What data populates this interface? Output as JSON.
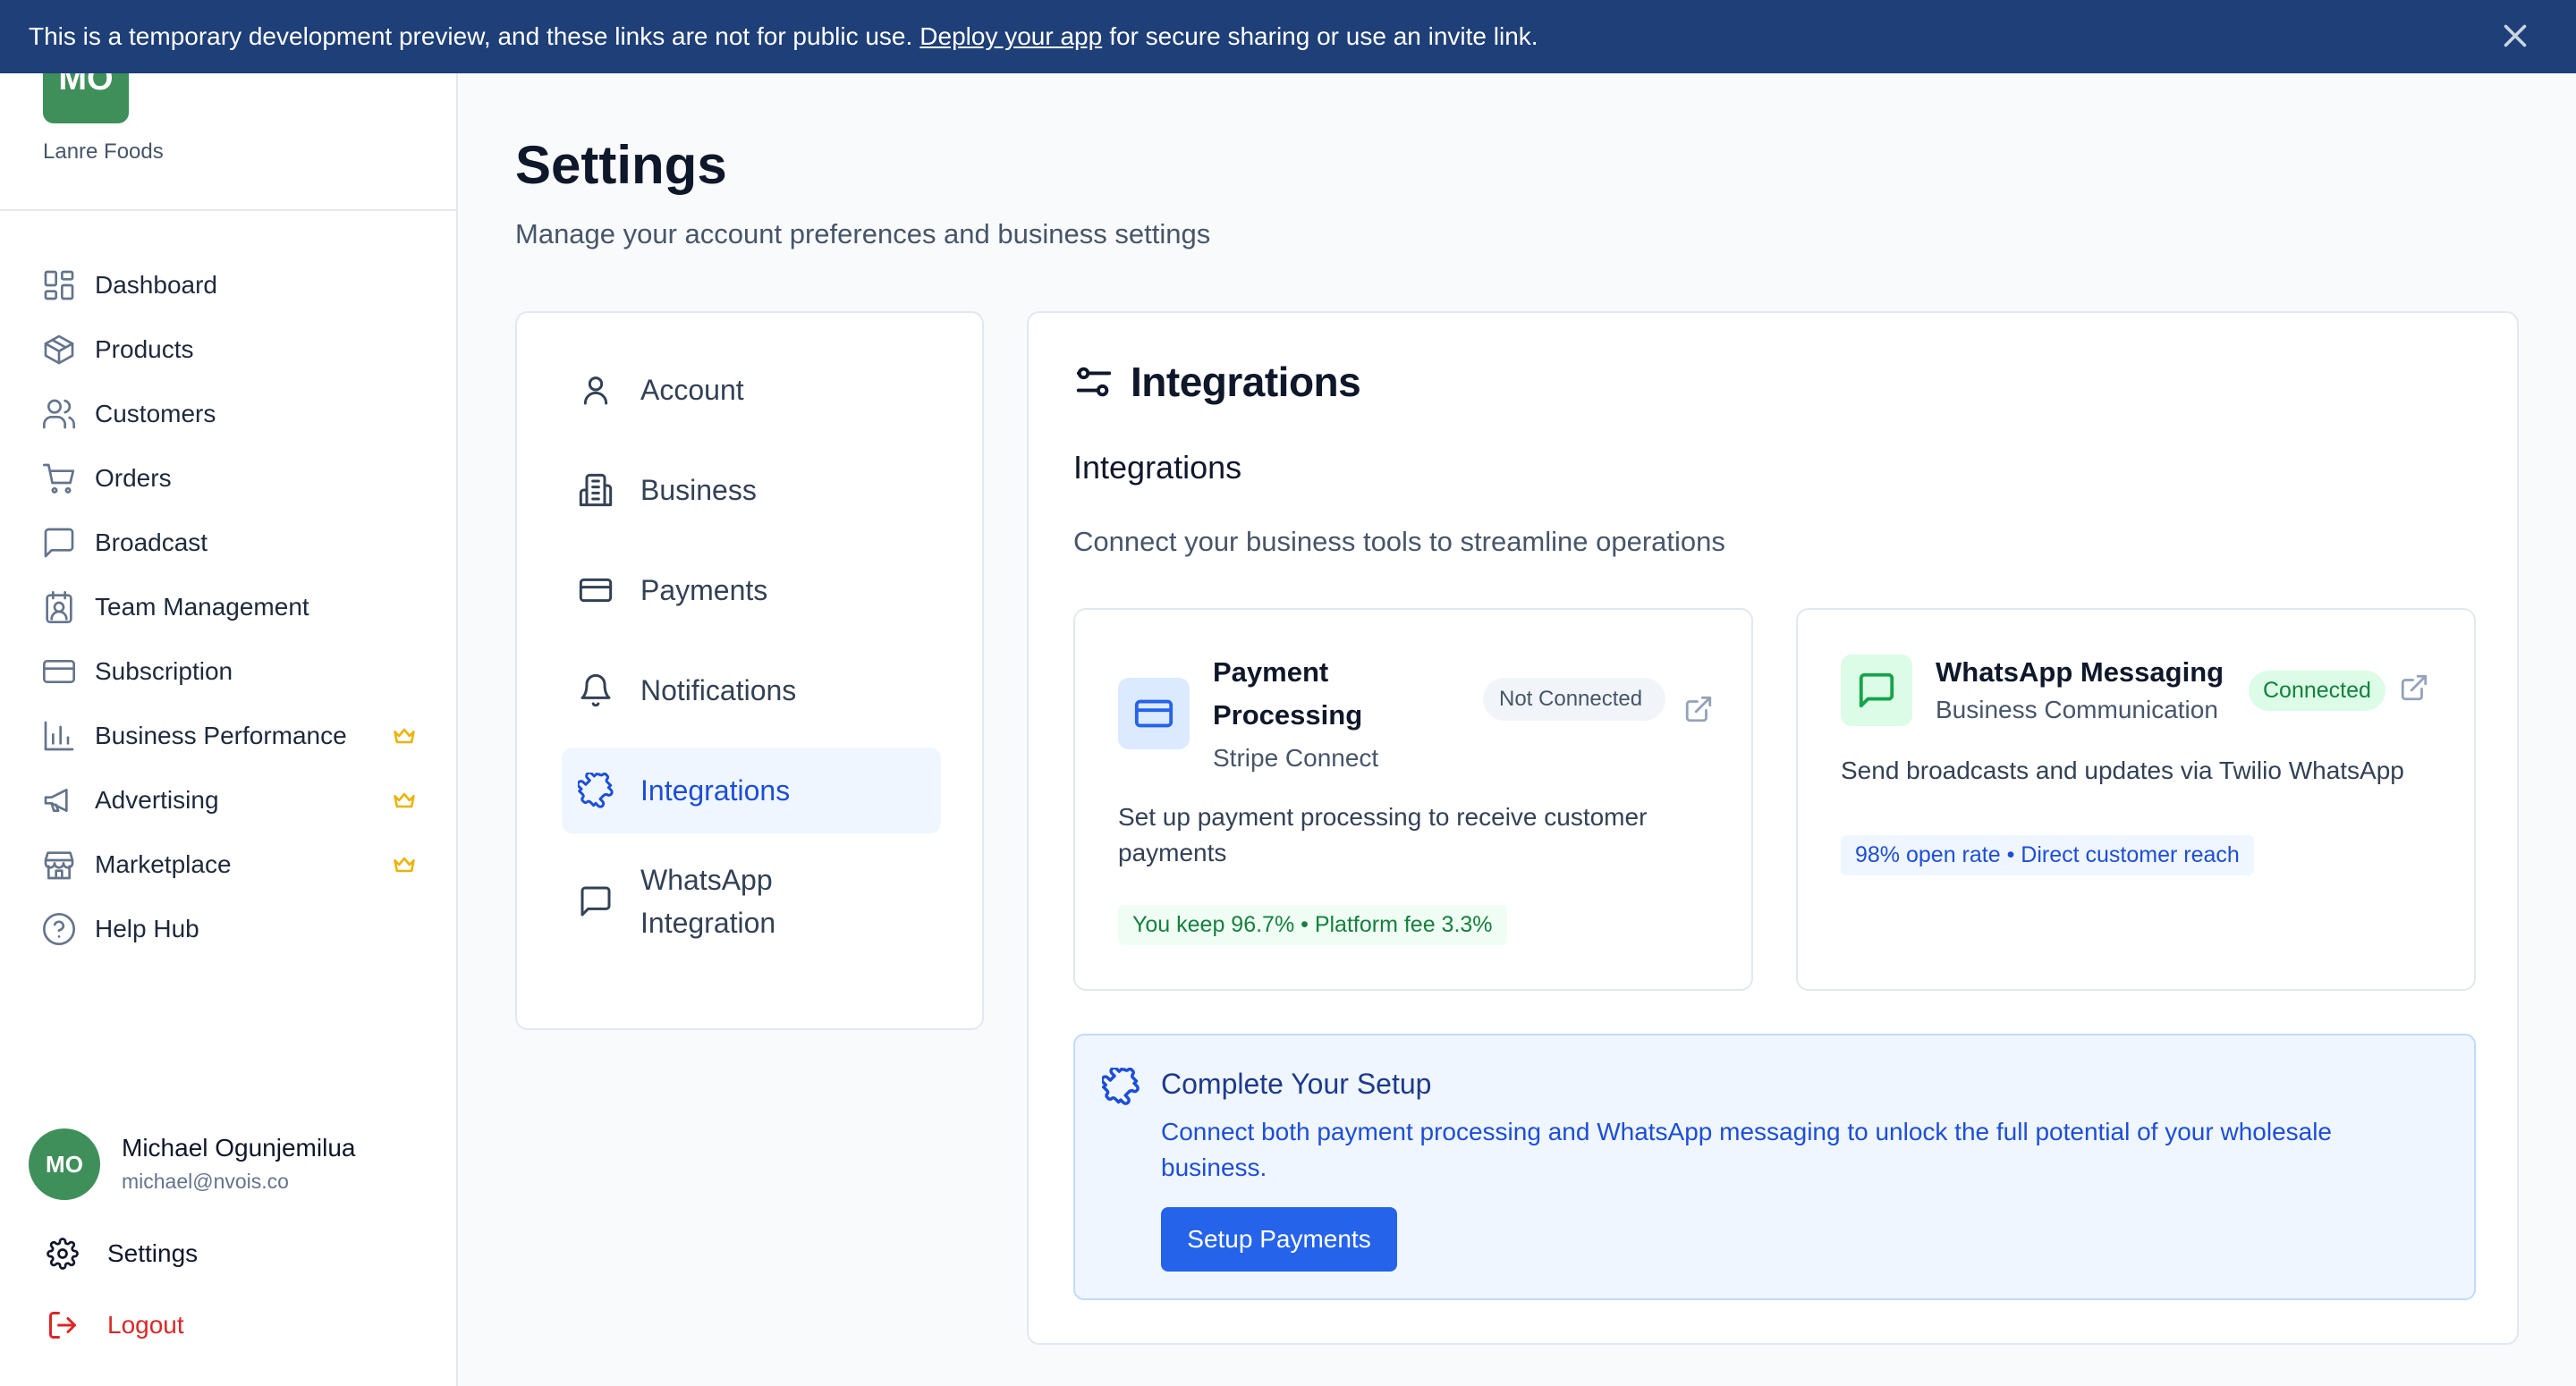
{
  "banner": {
    "text_before": "This is a temporary development preview, and these links are not for public use.",
    "link": "Deploy your app",
    "text_after": "for secure sharing or use an invite link."
  },
  "sidebar": {
    "logo_initials": "MO",
    "business_name": "Lanre Foods",
    "items": [
      {
        "label": "Dashboard",
        "icon": "dashboard-icon"
      },
      {
        "label": "Products",
        "icon": "box-icon"
      },
      {
        "label": "Customers",
        "icon": "users-icon"
      },
      {
        "label": "Orders",
        "icon": "cart-icon"
      },
      {
        "label": "Broadcast",
        "icon": "message-icon"
      },
      {
        "label": "Team Management",
        "icon": "contact-icon"
      },
      {
        "label": "Subscription",
        "icon": "card-icon"
      },
      {
        "label": "Business Performance",
        "icon": "bar-chart-icon",
        "premium": true
      },
      {
        "label": "Advertising",
        "icon": "megaphone-icon",
        "premium": true
      },
      {
        "label": "Marketplace",
        "icon": "store-icon",
        "premium": true
      },
      {
        "label": "Help Hub",
        "icon": "help-icon"
      }
    ],
    "user": {
      "initials": "MO",
      "name": "Michael Ogunjemilua",
      "email": "michael@nvois.co"
    },
    "settings_label": "Settings",
    "logout_label": "Logout"
  },
  "page": {
    "title": "Settings",
    "subtitle": "Manage your account preferences and business settings"
  },
  "settings_nav": {
    "items": [
      {
        "label": "Account",
        "icon": "user-icon"
      },
      {
        "label": "Business",
        "icon": "building-icon"
      },
      {
        "label": "Payments",
        "icon": "card-icon"
      },
      {
        "label": "Notifications",
        "icon": "bell-icon"
      },
      {
        "label": "Integrations",
        "icon": "puzzle-icon",
        "active": true
      },
      {
        "label": "WhatsApp Integration",
        "icon": "message-icon"
      }
    ]
  },
  "integrations": {
    "header": "Integrations",
    "section_title": "Integrations",
    "description": "Connect your business tools to streamline operations",
    "payment": {
      "title": "Payment Processing",
      "subtitle": "Stripe Connect",
      "status": "Not Connected",
      "description": "Set up payment processing to receive customer payments",
      "pill": "You keep 96.7% • Platform fee 3.3%"
    },
    "whatsapp": {
      "title": "WhatsApp Messaging",
      "subtitle": "Business Communication",
      "status": "Connected",
      "description": "Send broadcasts and updates via Twilio WhatsApp",
      "pill": "98% open rate • Direct customer reach"
    },
    "setup": {
      "title": "Complete Your Setup",
      "description": "Connect both payment processing and WhatsApp messaging to unlock the full potential of your wholesale business.",
      "button": "Setup Payments"
    }
  },
  "colors": {
    "banner": "#1e3f78",
    "brand_green": "#3f8f5a",
    "accent_blue": "#2563eb",
    "danger": "#dc2626",
    "premium": "#eab308"
  }
}
